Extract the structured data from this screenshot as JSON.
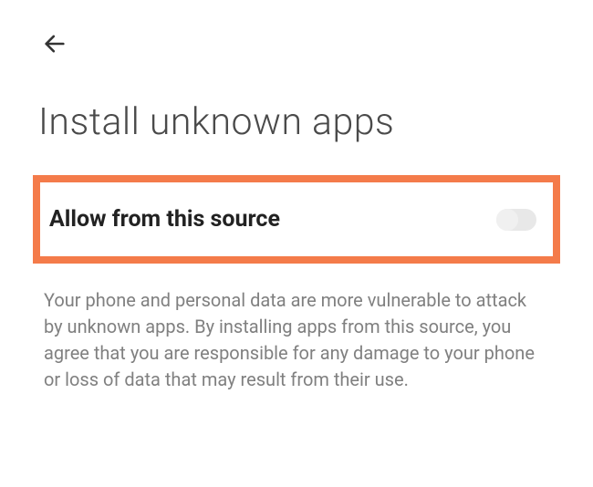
{
  "header": {
    "back_icon": "back-arrow"
  },
  "page": {
    "title": "Install unknown apps"
  },
  "setting": {
    "label": "Allow from this source",
    "enabled": false,
    "highlight_color": "#f47b4a"
  },
  "description": {
    "text": "Your phone and personal data are more vulnerable to attack by unknown apps. By installing apps from this source, you agree that you are responsible for any damage to your phone or loss of data that may result from their use."
  }
}
